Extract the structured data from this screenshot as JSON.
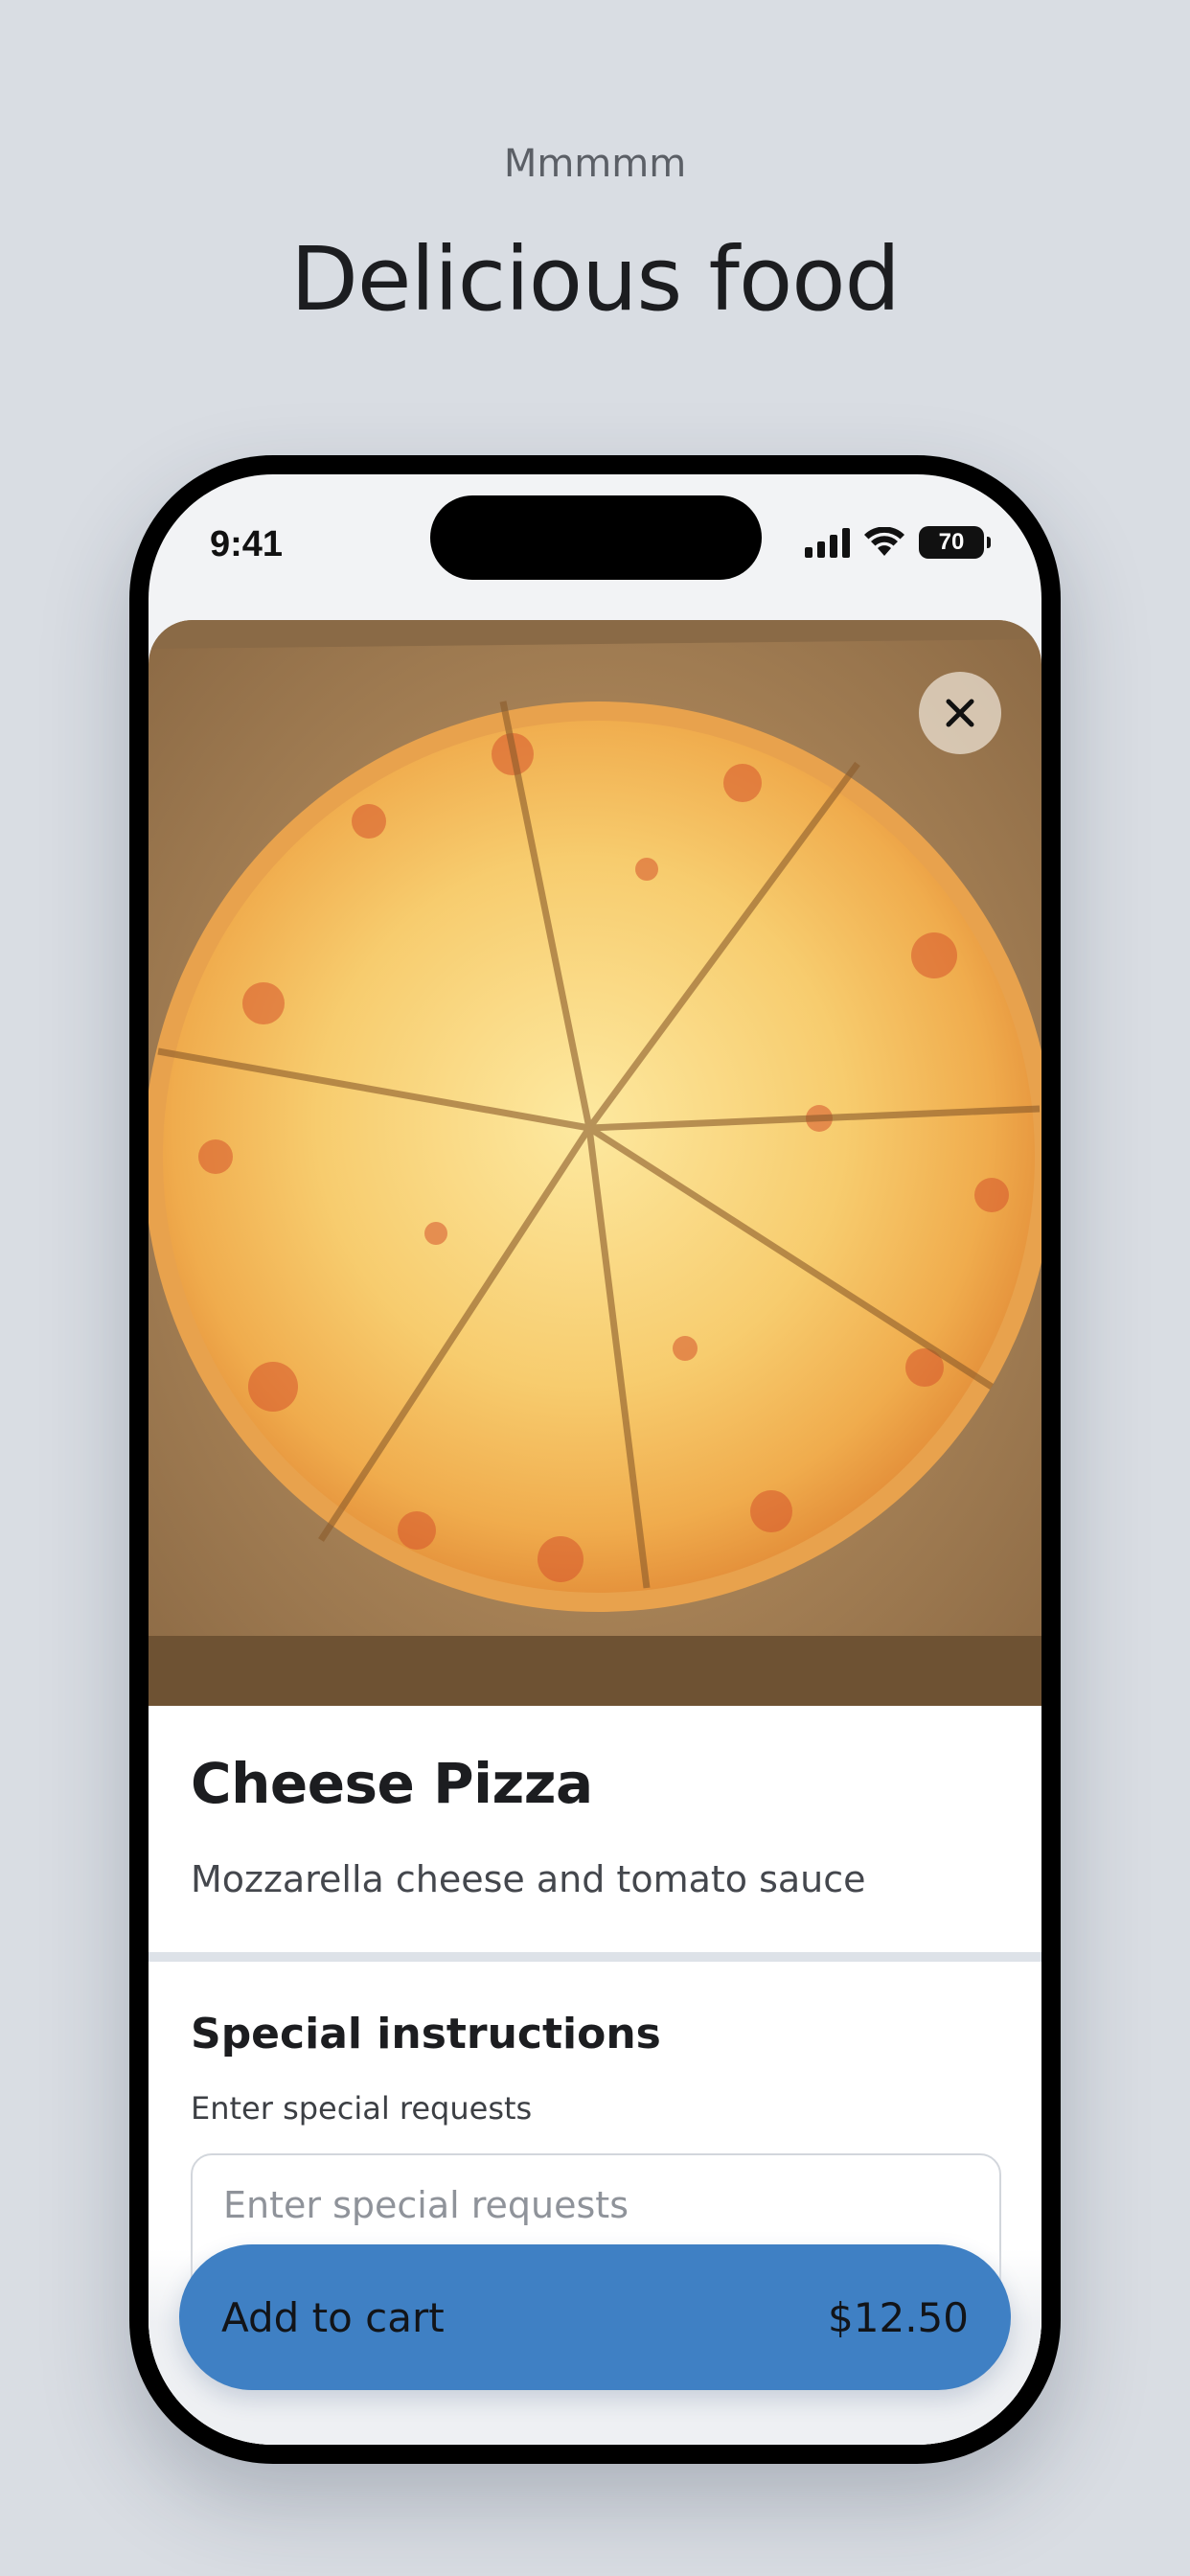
{
  "header": {
    "eyebrow": "Mmmmm",
    "headline": "Delicious food"
  },
  "statusbar": {
    "time": "9:41",
    "battery_level": "70",
    "icons": [
      "signal-icon",
      "wifi-icon",
      "battery-icon"
    ]
  },
  "item": {
    "image_icon": "pizza-photo",
    "close_icon": "close-icon",
    "name": "Cheese Pizza",
    "description": "Mozzarella cheese and tomato sauce"
  },
  "instructions": {
    "title": "Special instructions",
    "label": "Enter special requests",
    "placeholder": "Enter special requests",
    "value": ""
  },
  "cart": {
    "label": "Add to cart",
    "price": "$12.50"
  },
  "colors": {
    "background": "#d9dde3",
    "accent": "#3f80c4",
    "device_frame": "#000000"
  }
}
